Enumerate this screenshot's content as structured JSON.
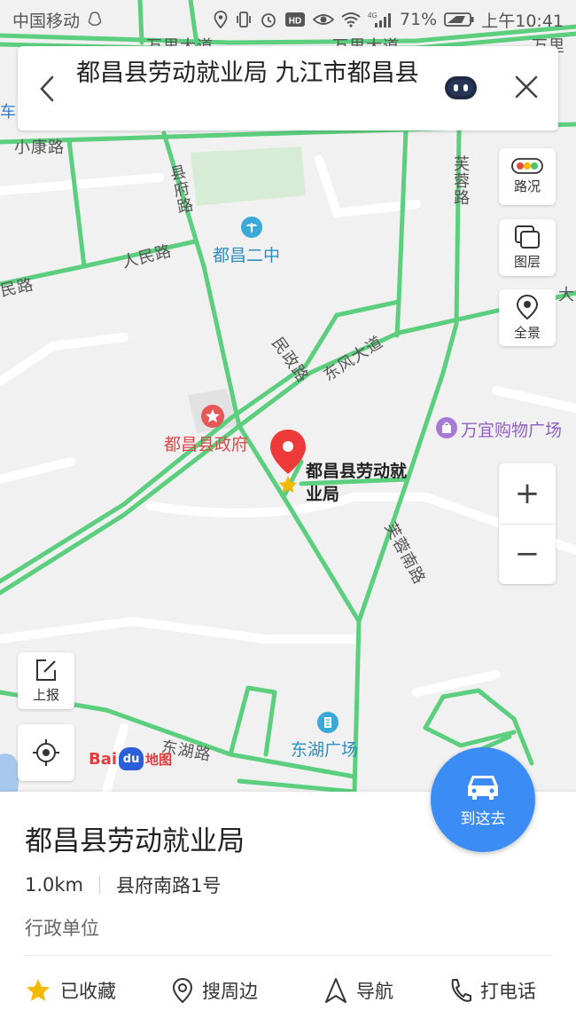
{
  "status_bar": {
    "carrier": "中国移动",
    "battery": "71%",
    "time": "上午10:41",
    "icons": [
      "qq-icon",
      "location-icon",
      "vibrate-icon",
      "alarm-icon",
      "hd-icon",
      "eye-icon",
      "wifi-icon",
      "4g-signal-icon",
      "battery-icon"
    ]
  },
  "search": {
    "query": "都昌县劳动就业局 九江市都昌县"
  },
  "map_controls": {
    "traffic": "路况",
    "layers": "图层",
    "panorama": "全景",
    "report": "上报",
    "zoom_in": "+",
    "zoom_out": "−"
  },
  "map_labels": {
    "wanli_road_1": "万里大道",
    "wanli_road_2": "万里大道",
    "wanli_road_3": "万里",
    "che": "车",
    "xiaokang_road": "小康路",
    "xianfu_road": "县府路",
    "renmin_road_1": "人民路",
    "renmin_road_2": "民路",
    "furong_road": "芙蓉路",
    "minzheng_road": "民政路",
    "dongfeng_ave": "东风大道",
    "furong_south": "芙蓉南路",
    "donghu_road": "东湖路",
    "da": "大",
    "school": "都昌二中",
    "government": "都昌县政府",
    "mall": "万宜购物广场",
    "donghu_square": "东湖广场",
    "pin_label_line1": "都昌县劳动就",
    "pin_label_line2": "业局",
    "logo_bai": "Bai",
    "logo_du": "du",
    "logo_map": "地图"
  },
  "go_button": "到这去",
  "poi": {
    "name": "都昌县劳动就业局",
    "distance": "1.0km",
    "address": "县府南路1号",
    "category": "行政单位"
  },
  "actions": {
    "favorite": "已收藏",
    "nearby": "搜周边",
    "navigate": "导航",
    "call": "打电话"
  },
  "colors": {
    "road": "#5ccf7e",
    "accent": "#3c8cf6",
    "pin": "#ef3a3a",
    "star": "#f5b800",
    "park": "#d6ecd4"
  }
}
